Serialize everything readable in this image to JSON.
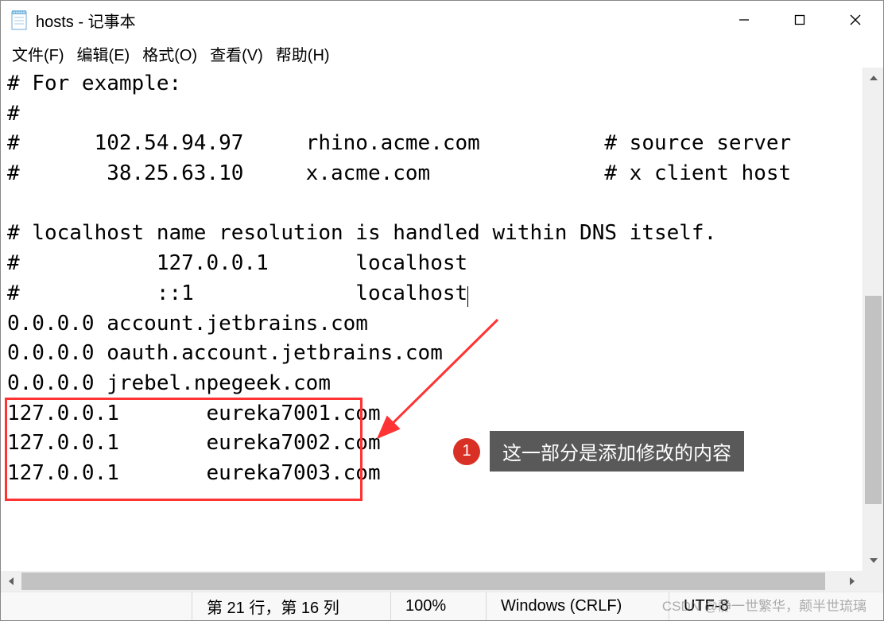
{
  "titlebar": {
    "title": "hosts - 记事本"
  },
  "menubar": {
    "file": "文件(F)",
    "edit": "编辑(E)",
    "format": "格式(O)",
    "view": "查看(V)",
    "help": "帮助(H)"
  },
  "content": {
    "line1": "# For example:",
    "line2": "#",
    "line3": "#      102.54.94.97     rhino.acme.com          # source server",
    "line4": "#       38.25.63.10     x.acme.com              # x client host",
    "line5": "",
    "line6": "# localhost name resolution is handled within DNS itself.",
    "line7": "#           127.0.0.1       localhost",
    "line8": "#           ::1             localhost",
    "line9": "0.0.0.0 account.jetbrains.com",
    "line10": "0.0.0.0 oauth.account.jetbrains.com",
    "line11": "0.0.0.0 jrebel.npegeek.com",
    "line12": "127.0.0.1       eureka7001.com",
    "line13": "127.0.0.1       eureka7002.com",
    "line14": "127.0.0.1       eureka7003.com"
  },
  "statusbar": {
    "position": "第 21 行，第 16 列",
    "zoom": "100%",
    "lineending": "Windows (CRLF)",
    "encoding": "UTF-8"
  },
  "annotation": {
    "badge": "1",
    "text": "这一部分是添加修改的内容"
  },
  "watermark": "CSDN @静一世繁华，颠半世琉璃"
}
